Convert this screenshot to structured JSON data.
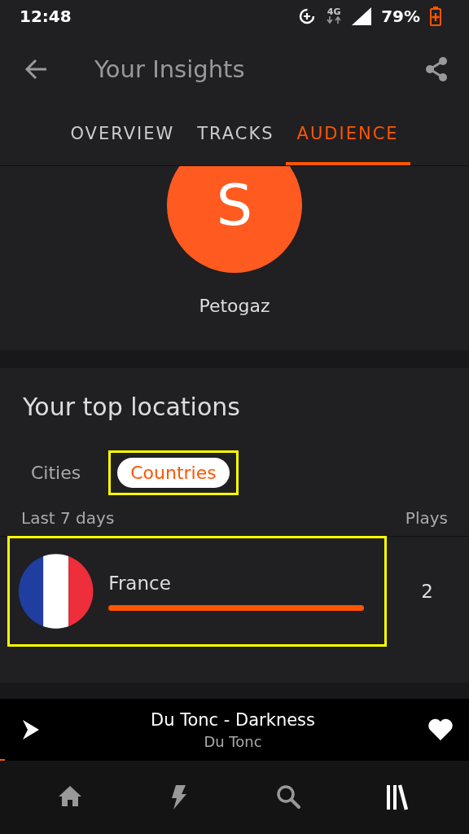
{
  "status_bar": {
    "time": "12:48",
    "network": "4G",
    "battery": "79%"
  },
  "app_bar": {
    "title": "Your Insights"
  },
  "tabs": [
    {
      "label": "OVERVIEW",
      "selected": false
    },
    {
      "label": "TRACKS",
      "selected": false
    },
    {
      "label": "AUDIENCE",
      "selected": true
    }
  ],
  "profile": {
    "initial": "S",
    "name": "Petogaz"
  },
  "top_locations": {
    "title": "Your top locations",
    "filters": [
      {
        "label": "Cities",
        "selected": false,
        "highlighted": false
      },
      {
        "label": "Countries",
        "selected": true,
        "highlighted": true
      }
    ],
    "period": "Last 7 days",
    "plays_header": "Plays",
    "rows": [
      {
        "name": "France",
        "plays": "2",
        "highlighted": true
      }
    ]
  },
  "mini_player": {
    "title": "Du Tonc - Darkness",
    "artist": "Du Tonc",
    "level": 0.01,
    "liked": true
  },
  "bottom_nav": [
    {
      "kind": "home",
      "selected": false
    },
    {
      "kind": "stream",
      "selected": false
    },
    {
      "kind": "search",
      "selected": false
    },
    {
      "kind": "library",
      "selected": true
    }
  ]
}
